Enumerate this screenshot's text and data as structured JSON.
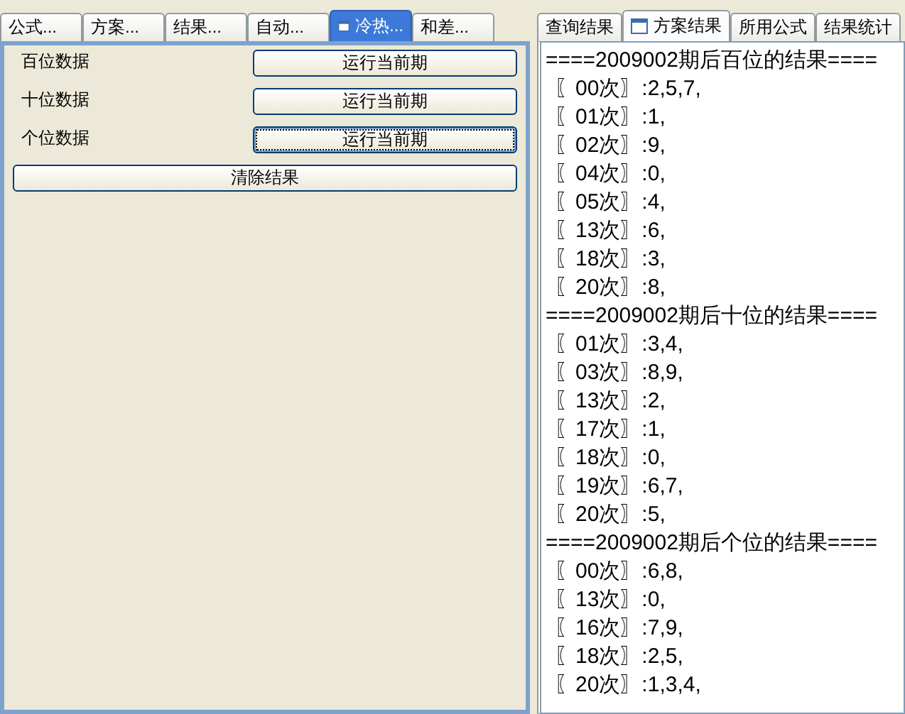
{
  "left_tabs": [
    {
      "label": "公式...",
      "selected": false
    },
    {
      "label": "方案...",
      "selected": false
    },
    {
      "label": "结果...",
      "selected": false
    },
    {
      "label": "自动...",
      "selected": false
    },
    {
      "label": "冷热...",
      "selected": true
    },
    {
      "label": "和差...",
      "selected": false
    }
  ],
  "rows": [
    {
      "label": "百位数据",
      "button": "运行当前期",
      "focused": false
    },
    {
      "label": "十位数据",
      "button": "运行当前期",
      "focused": false
    },
    {
      "label": "个位数据",
      "button": "运行当前期",
      "focused": true
    }
  ],
  "clear_button": "清除结果",
  "right_tabs": [
    {
      "label": "查询结果",
      "selected": false
    },
    {
      "label": "方案结果",
      "selected": true
    },
    {
      "label": "所用公式",
      "selected": false
    },
    {
      "label": "结果统计",
      "selected": false
    }
  ],
  "lines": [
    {
      "kind": "header",
      "text": "====2009002期后百位的结果===="
    },
    {
      "kind": "entry",
      "text": "〖00次〗:2,5,7,"
    },
    {
      "kind": "entry",
      "text": "〖01次〗:1,"
    },
    {
      "kind": "entry",
      "text": "〖02次〗:9,"
    },
    {
      "kind": "entry",
      "text": "〖04次〗:0,"
    },
    {
      "kind": "entry",
      "text": "〖05次〗:4,"
    },
    {
      "kind": "entry",
      "text": "〖13次〗:6,"
    },
    {
      "kind": "entry",
      "text": "〖18次〗:3,"
    },
    {
      "kind": "entry",
      "text": "〖20次〗:8,"
    },
    {
      "kind": "header",
      "text": "====2009002期后十位的结果===="
    },
    {
      "kind": "entry",
      "text": "〖01次〗:3,4,"
    },
    {
      "kind": "entry",
      "text": "〖03次〗:8,9,"
    },
    {
      "kind": "entry",
      "text": "〖13次〗:2,"
    },
    {
      "kind": "entry",
      "text": "〖17次〗:1,"
    },
    {
      "kind": "entry",
      "text": "〖18次〗:0,"
    },
    {
      "kind": "entry",
      "text": "〖19次〗:6,7,"
    },
    {
      "kind": "entry",
      "text": "〖20次〗:5,"
    },
    {
      "kind": "header",
      "text": "====2009002期后个位的结果===="
    },
    {
      "kind": "entry",
      "text": "〖00次〗:6,8,"
    },
    {
      "kind": "entry",
      "text": "〖13次〗:0,"
    },
    {
      "kind": "entry",
      "text": "〖16次〗:7,9,"
    },
    {
      "kind": "entry",
      "text": "〖18次〗:2,5,"
    },
    {
      "kind": "entry",
      "text": "〖20次〗:1,3,4,"
    }
  ]
}
